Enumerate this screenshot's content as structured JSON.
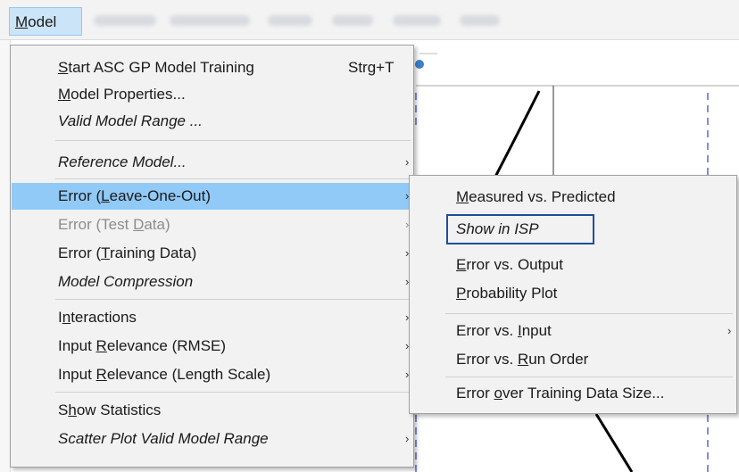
{
  "menubar": {
    "model_label": "Model",
    "other_menus_obscured": true
  },
  "model_menu": {
    "items": [
      {
        "label_pre": "",
        "mnemonic": "S",
        "label_post": "tart ASC GP Model Training",
        "shortcut": "Strg+T",
        "italic": false
      },
      {
        "label_pre": "",
        "mnemonic": "M",
        "label_post": "odel Properties...",
        "italic": false
      },
      {
        "label_pre": "Valid Model Range ...",
        "mnemonic": "",
        "label_post": "",
        "italic": true
      },
      {
        "label_pre": "Reference Model...",
        "mnemonic": "",
        "label_post": "",
        "italic": true,
        "submenu": true
      },
      {
        "label_pre": "Error (",
        "mnemonic": "L",
        "label_post": "eave-One-Out)",
        "italic": false,
        "submenu": true,
        "highlighted": true
      },
      {
        "label_pre": "Error (Test ",
        "mnemonic": "D",
        "label_post": "ata)",
        "italic": false,
        "submenu": true,
        "disabled": true
      },
      {
        "label_pre": "Error (",
        "mnemonic": "T",
        "label_post": "raining Data)",
        "italic": false,
        "submenu": true
      },
      {
        "label_pre": "Model Compression",
        "mnemonic": "",
        "label_post": "",
        "italic": true,
        "submenu": true
      },
      {
        "label_pre": "I",
        "mnemonic": "n",
        "label_post": "teractions",
        "italic": false,
        "submenu": true
      },
      {
        "label_pre": "Input ",
        "mnemonic": "R",
        "label_post": "elevance (RMSE)",
        "italic": false,
        "submenu": true
      },
      {
        "label_pre": "Input ",
        "mnemonic": "R",
        "label_post": "elevance (Length Scale)",
        "italic": false,
        "submenu": true
      },
      {
        "label_pre": "S",
        "mnemonic": "h",
        "label_post": "ow Statistics",
        "italic": false
      },
      {
        "label_pre": "Scatter Plot Valid Model Range",
        "mnemonic": "",
        "label_post": "",
        "italic": true,
        "submenu": true
      }
    ],
    "arrow_glyph": "›"
  },
  "submenu": {
    "items": [
      {
        "label_pre": "",
        "mnemonic": "M",
        "label_post": "easured vs. Predicted",
        "italic": false
      },
      {
        "label_pre": "Show in ISP",
        "mnemonic": "",
        "label_post": "",
        "italic": true,
        "focused": true
      },
      {
        "label_pre": "",
        "mnemonic": "E",
        "label_post": "rror vs. Output",
        "italic": false
      },
      {
        "label_pre": "",
        "mnemonic": "P",
        "label_post": "robability Plot",
        "italic": false
      },
      {
        "label_pre": "Error vs. ",
        "mnemonic": "I",
        "label_post": "nput",
        "italic": false,
        "submenu": true
      },
      {
        "label_pre": "Error vs. ",
        "mnemonic": "R",
        "label_post": "un Order",
        "italic": false
      },
      {
        "label_pre": "Error ",
        "mnemonic": "o",
        "label_post": "ver Training Data Size...",
        "italic": false
      }
    ],
    "arrow_glyph": "›"
  },
  "colors": {
    "highlight": "#91c9f7",
    "menubar_active": "#cce4f7",
    "focus_border": "#1f4e99",
    "plot_dash": "#2f3fc8",
    "plot_curve": "#000000"
  }
}
